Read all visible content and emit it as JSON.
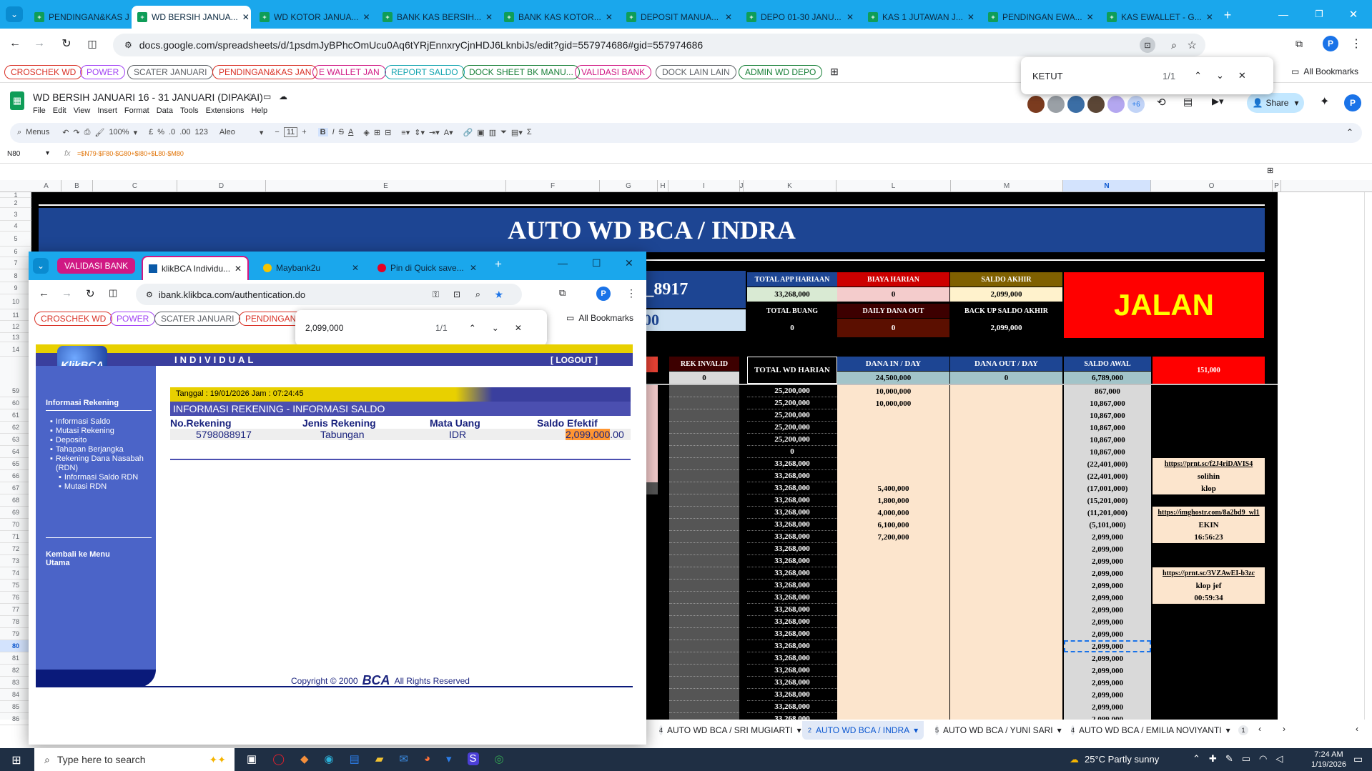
{
  "browser": {
    "tabs": [
      {
        "label": "PENDINGAN&KAS JAN"
      },
      {
        "label": "WD BERSIH JANUA..."
      },
      {
        "label": "WD KOTOR JANUA..."
      },
      {
        "label": "BANK KAS BERSIH..."
      },
      {
        "label": "BANK KAS KOTOR..."
      },
      {
        "label": "DEPOSIT MANUA..."
      },
      {
        "label": "DEPO 01-30 JANU..."
      },
      {
        "label": "KAS 1 JUTAWAN J..."
      },
      {
        "label": "PENDINGAN EWA..."
      },
      {
        "label": "KAS EWALLET - G..."
      }
    ],
    "url": "docs.google.com/spreadsheets/d/1psdmJyBPhcOmUcu0Aq6tYRjEnnxryCjnHDJ6LknbiJs/edit?gid=557974686#gid=557974686",
    "bookmarks": [
      {
        "label": "CROSCHEK WD",
        "color": "#d93025"
      },
      {
        "label": "POWER",
        "color": "#a142f4"
      },
      {
        "label": "SCATER JANUARI",
        "color": "#5f6368"
      },
      {
        "label": "PENDINGAN&KAS JAN",
        "color": "#d93025"
      },
      {
        "label": "E WALLET JAN",
        "color": "#d01884"
      },
      {
        "label": "REPORT SALDO",
        "color": "#12a4af"
      },
      {
        "label": "DOCK SHEET BK MANU...",
        "color": "#188038"
      },
      {
        "label": "VALIDASI BANK",
        "color": "#d01884"
      },
      {
        "label": "DOCK LAIN LAIN",
        "color": "#5f6368"
      },
      {
        "label": "ADMIN WD DEPO",
        "color": "#188038"
      }
    ],
    "all_bookmarks": "All Bookmarks",
    "find": {
      "query": "KETUT",
      "count": "1/1"
    }
  },
  "sheets": {
    "title": "WD BERSIH JANUARI 16 - 31 JANUARI (DIPAKAI)",
    "menu": [
      "File",
      "Edit",
      "View",
      "Insert",
      "Format",
      "Data",
      "Tools",
      "Extensions",
      "Help"
    ],
    "share": "Share",
    "collab_extra": "+6",
    "toolbar": {
      "menus": "Menus",
      "zoom": "100%",
      "currency": "£",
      "percent": "%",
      "dec_dec": ".0",
      "dec_inc": ".00",
      "num": "123",
      "font": "Aleo",
      "size": "11"
    },
    "name_box": "N80",
    "formula": "=$N79-$F80-$G80+$I80+$L80-$M80",
    "columns": [
      "A",
      "B",
      "C",
      "D",
      "E",
      "F",
      "G",
      "H",
      "I",
      "J",
      "K",
      "L",
      "M",
      "N",
      "O",
      "P"
    ],
    "header_title": "AUTO WD BCA / INDRA",
    "account_suffix": "A_8917",
    "account_amount": "00",
    "summary": {
      "total_app_harian_label": "TOTAL APP HARIAAN",
      "total_app_harian": "33,268,000",
      "biaya_harian_label": "BIAYA HARIAN",
      "biaya_harian": "0",
      "saldo_akhir_label": "SALDO AKHIR",
      "saldo_akhir": "2,099,000",
      "total_buang_label": "TOTAL BUANG",
      "total_buang": "0",
      "daily_dana_out_label": "DAILY DANA OUT",
      "daily_dana_out": "0",
      "backup_saldo_label": "BACK UP SALDO AKHIR",
      "backup_saldo": "2,099,000",
      "status": "JALAN"
    },
    "table_header": {
      "n_fragment": "N",
      "rek_invalid": "REK INVALID",
      "rek_invalid_val": "0",
      "total_wd_harian": "TOTAL WD HARIAN",
      "dana_in": "DANA IN / DAY",
      "dana_in_val": "24,500,000",
      "dana_out": "DANA OUT / DAY",
      "dana_out_val": "0",
      "saldo_awal": "SALDO AWAL",
      "saldo_awal_val": "6,789,000",
      "o_val": "151,000"
    },
    "rows": [
      {
        "n": "59",
        "k": "25,200,000",
        "l": "10,000,000",
        "nv": "867,000",
        "o": ""
      },
      {
        "n": "60",
        "k": "25,200,000",
        "l": "10,000,000",
        "nv": "10,867,000",
        "o": ""
      },
      {
        "n": "61",
        "k": "25,200,000",
        "l": "",
        "nv": "10,867,000",
        "o": ""
      },
      {
        "n": "62",
        "k": "25,200,000",
        "l": "",
        "nv": "10,867,000",
        "o": ""
      },
      {
        "n": "63",
        "k": "25,200,000",
        "l": "",
        "nv": "10,867,000",
        "o": ""
      },
      {
        "n": "64",
        "k": "0",
        "l": "",
        "nv": "10,867,000",
        "o": ""
      },
      {
        "n": "65",
        "k": "33,268,000",
        "l": "",
        "nv": "(22,401,000)",
        "o": "https://prnt.sc/f2J4riDAVIS4"
      },
      {
        "n": "66",
        "k": "33,268,000",
        "l": "",
        "nv": "(22,401,000)",
        "o": "solihin"
      },
      {
        "n": "67",
        "k": "33,268,000",
        "l": "5,400,000",
        "nv": "(17,001,000)",
        "o": "klop"
      },
      {
        "n": "68",
        "k": "33,268,000",
        "l": "1,800,000",
        "nv": "(15,201,000)",
        "o": ""
      },
      {
        "n": "69",
        "k": "33,268,000",
        "l": "4,000,000",
        "nv": "(11,201,000)",
        "o": "https://imghostr.com/8a2bd9_wl1"
      },
      {
        "n": "70",
        "k": "33,268,000",
        "l": "6,100,000",
        "nv": "(5,101,000)",
        "o": "EKIN"
      },
      {
        "n": "71",
        "k": "33,268,000",
        "l": "7,200,000",
        "nv": "2,099,000",
        "o": "16:56:23"
      },
      {
        "n": "72",
        "k": "33,268,000",
        "l": "",
        "nv": "2,099,000",
        "o": ""
      },
      {
        "n": "73",
        "k": "33,268,000",
        "l": "",
        "nv": "2,099,000",
        "o": ""
      },
      {
        "n": "74",
        "k": "33,268,000",
        "l": "",
        "nv": "2,099,000",
        "o": "https://prnt.sc/3VZAwEI-b3zc"
      },
      {
        "n": "75",
        "k": "33,268,000",
        "l": "",
        "nv": "2,099,000",
        "o": "klop jef"
      },
      {
        "n": "76",
        "k": "33,268,000",
        "l": "",
        "nv": "2,099,000",
        "o": "00:59:34"
      },
      {
        "n": "77",
        "k": "33,268,000",
        "l": "",
        "nv": "2,099,000",
        "o": ""
      },
      {
        "n": "78",
        "k": "33,268,000",
        "l": "",
        "nv": "2,099,000",
        "o": ""
      },
      {
        "n": "79",
        "k": "33,268,000",
        "l": "",
        "nv": "2,099,000",
        "o": ""
      },
      {
        "n": "80",
        "k": "33,268,000",
        "l": "",
        "nv": "2,099,000",
        "o": ""
      },
      {
        "n": "81",
        "k": "33,268,000",
        "l": "",
        "nv": "2,099,000",
        "o": ""
      },
      {
        "n": "82",
        "k": "33,268,000",
        "l": "",
        "nv": "2,099,000",
        "o": ""
      },
      {
        "n": "83",
        "k": "33,268,000",
        "l": "",
        "nv": "2,099,000",
        "o": ""
      },
      {
        "n": "84",
        "k": "33,268,000",
        "l": "",
        "nv": "2,099,000",
        "o": ""
      },
      {
        "n": "85",
        "k": "33,268,000",
        "l": "",
        "nv": "2,099,000",
        "o": ""
      },
      {
        "n": "86",
        "k": "33,268,000",
        "l": "",
        "nv": "2,099,000",
        "o": ""
      }
    ],
    "top_rows": [
      "1",
      "2",
      "3",
      "4",
      "5",
      "6",
      "7",
      "8",
      "9",
      "10",
      "11",
      "12",
      "13",
      "14"
    ],
    "sheet_tabs": [
      {
        "label": "AUTO WD BCA / SRI MUGIARTI",
        "num": "4"
      },
      {
        "label": "AUTO WD BCA / INDRA",
        "num": "2"
      },
      {
        "label": "AUTO WD BCA / YUNI SARI",
        "num": "5"
      },
      {
        "label": "AUTO WD BCA / EMILIA NOVIYANTI",
        "num": "4"
      }
    ],
    "sheet_tab_more": "1"
  },
  "overlay": {
    "tabs": [
      {
        "label": "VALIDASI BANK"
      },
      {
        "label": "klikBCA Individu..."
      },
      {
        "label": "Maybank2u"
      },
      {
        "label": "Pin di Quick save..."
      }
    ],
    "url": "ibank.klikbca.com/authentication.do",
    "bookmarks": [
      "CROSCHEK WD",
      "POWER",
      "SCATER JANUARI",
      "PENDINGAN"
    ],
    "all_bookmarks": "All Bookmarks",
    "find": {
      "query": "2,099,000",
      "count": "1/1"
    }
  },
  "bca": {
    "logo": "KlikBCA",
    "section": "INDIVIDUAL",
    "logout": "[ LOGOUT ]",
    "sidebar_title": "Informasi Rekening",
    "sidebar_items": [
      "Informasi Saldo",
      "Mutasi Rekening",
      "Deposito",
      "Tahapan Berjangka",
      "Rekening Dana Nasabah (RDN)"
    ],
    "sidebar_sub": [
      "Informasi Saldo RDN",
      "Mutasi RDN"
    ],
    "back": "Kembali ke Menu Utama",
    "date": "Tanggal : 19/01/2026 Jam : 07:24:45",
    "info_title": "INFORMASI REKENING - INFORMASI SALDO",
    "headers": [
      "No.Rekening",
      "Jenis Rekening",
      "Mata Uang",
      "Saldo Efektif"
    ],
    "row": {
      "no": "5798088917",
      "jenis": "Tabungan",
      "uang": "IDR",
      "saldo": "2,099,000",
      "saldo_dec": ".00"
    },
    "copyright": "Copyright © 2000",
    "copyright_brand": "BCA",
    "rights": "All Rights Reserved"
  },
  "taskbar": {
    "search": "Type here to search",
    "weather": "25°C  Partly sunny",
    "time": "7:24 AM",
    "date": "1/19/2026"
  }
}
